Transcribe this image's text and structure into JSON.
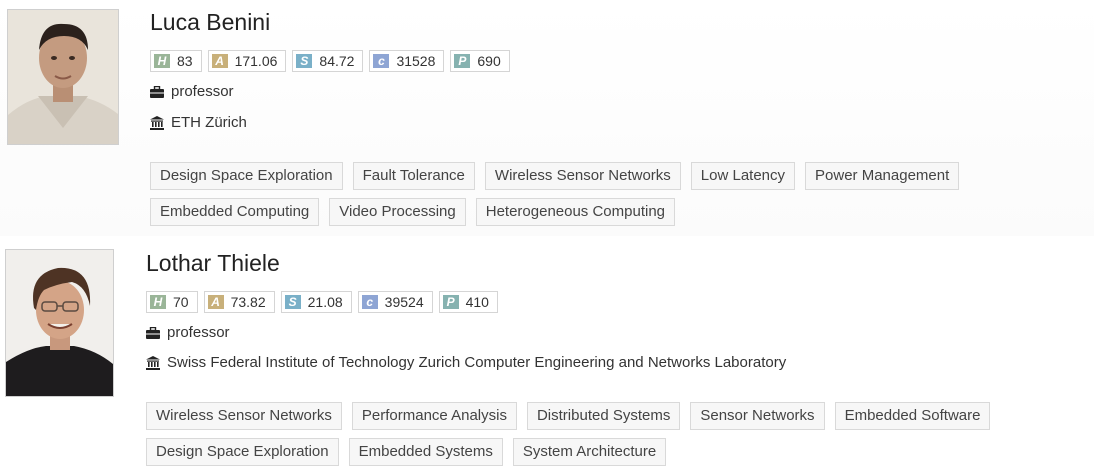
{
  "people": [
    {
      "name": "Luca Benini",
      "stats": [
        {
          "key": "H",
          "value": "83",
          "color": "#9ab598"
        },
        {
          "key": "A",
          "value": "171.06",
          "color": "#c8b07a"
        },
        {
          "key": "S",
          "value": "84.72",
          "color": "#7ab0c8"
        },
        {
          "key": "c",
          "value": "31528",
          "color": "#8ea5d4"
        },
        {
          "key": "P",
          "value": "690",
          "color": "#86b2b0"
        }
      ],
      "position": "professor",
      "organization": "ETH Zürich",
      "tags": [
        "Design Space Exploration",
        "Fault Tolerance",
        "Wireless Sensor Networks",
        "Low Latency",
        "Power Management",
        "Embedded Computing",
        "Video Processing",
        "Heterogeneous Computing"
      ]
    },
    {
      "name": "Lothar Thiele",
      "stats": [
        {
          "key": "H",
          "value": "70",
          "color": "#9ab598"
        },
        {
          "key": "A",
          "value": "73.82",
          "color": "#c8b07a"
        },
        {
          "key": "S",
          "value": "21.08",
          "color": "#7ab0c8"
        },
        {
          "key": "c",
          "value": "39524",
          "color": "#8ea5d4"
        },
        {
          "key": "P",
          "value": "410",
          "color": "#86b2b0"
        }
      ],
      "position": "professor",
      "organization": "Swiss Federal Institute of Technology Zurich Computer Engineering and Networks Laboratory",
      "tags": [
        "Wireless Sensor Networks",
        "Performance Analysis",
        "Distributed Systems",
        "Sensor Networks",
        "Embedded Software",
        "Design Space Exploration",
        "Embedded Systems",
        "System Architecture"
      ]
    }
  ],
  "icons": {
    "position": "briefcase-icon",
    "organization": "institution-icon"
  }
}
